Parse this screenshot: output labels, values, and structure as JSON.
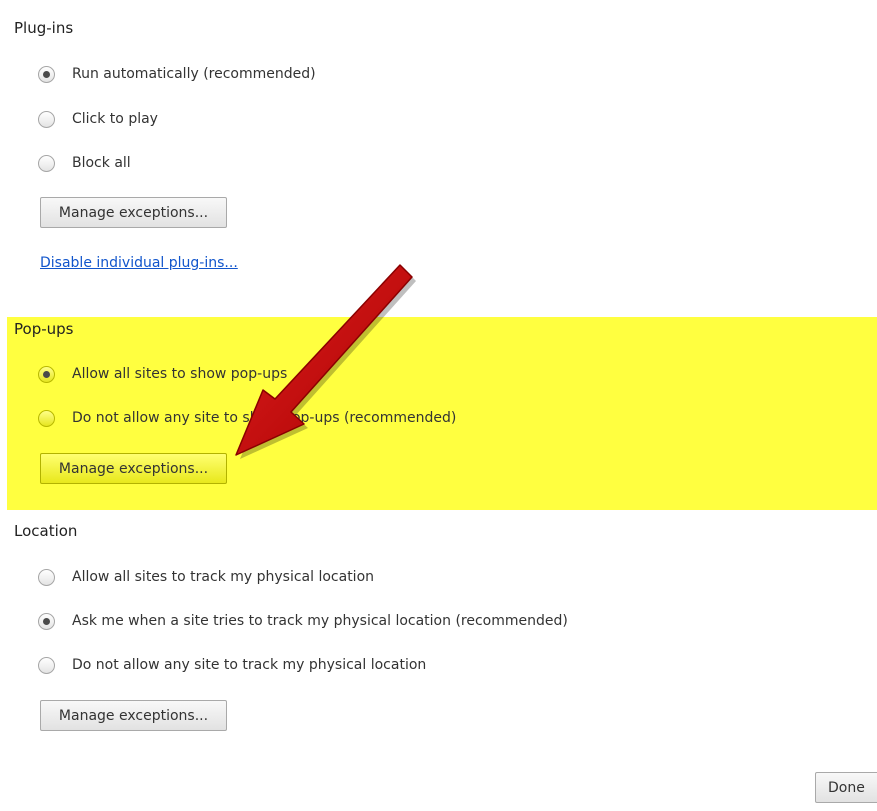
{
  "plugins": {
    "heading": "Plug-ins",
    "options": [
      {
        "label": "Run automatically (recommended)",
        "checked": true
      },
      {
        "label": "Click to play",
        "checked": false
      },
      {
        "label": "Block all",
        "checked": false
      }
    ],
    "manage_label": "Manage exceptions...",
    "disable_link": "Disable individual plug-ins..."
  },
  "popups": {
    "heading": "Pop-ups",
    "options": [
      {
        "label": "Allow all sites to show pop-ups",
        "checked": true
      },
      {
        "label": "Do not allow any site to show pop-ups (recommended)",
        "checked": false
      }
    ],
    "manage_label": "Manage exceptions...",
    "highlight_color": "#ffff40"
  },
  "location": {
    "heading": "Location",
    "options": [
      {
        "label": "Allow all sites to track my physical location",
        "checked": false
      },
      {
        "label": "Ask me when a site tries to track my physical location (recommended)",
        "checked": true
      },
      {
        "label": "Do not allow any site to track my physical location",
        "checked": false
      }
    ],
    "manage_label": "Manage exceptions..."
  },
  "done_label": "Done",
  "annotation": {
    "arrow_color": "#cc0000",
    "arrow_icon": "red-arrow-icon"
  }
}
